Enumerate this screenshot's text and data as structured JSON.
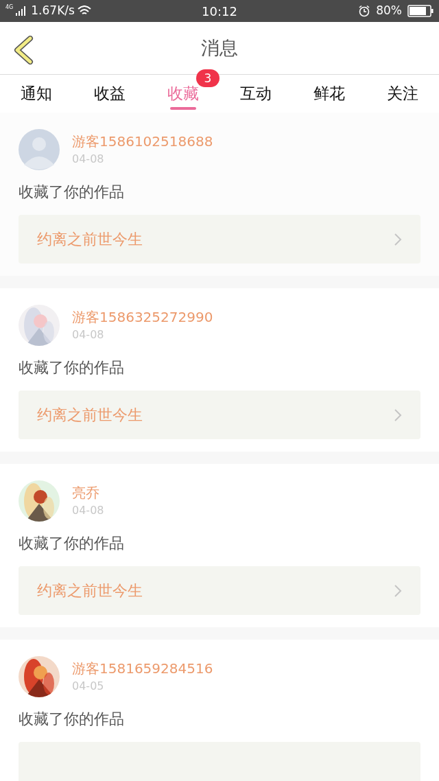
{
  "status_bar": {
    "network": "4G",
    "speed": "1.67K/s",
    "time": "10:12",
    "battery": "80%"
  },
  "header": {
    "title": "消息"
  },
  "tabs": [
    {
      "label": "通知",
      "selected": false
    },
    {
      "label": "收益",
      "selected": false
    },
    {
      "label": "收藏",
      "selected": true,
      "badge": "3"
    },
    {
      "label": "互动",
      "selected": false
    },
    {
      "label": "鲜花",
      "selected": false
    },
    {
      "label": "关注",
      "selected": false
    }
  ],
  "messages": [
    {
      "kind": "default",
      "name": "游客1586102518688",
      "date": "04-08",
      "action": "收藏了你的作品",
      "work": "约离之前世今生"
    },
    {
      "kind": "picture",
      "name": "游客1586325272990",
      "date": "04-08",
      "action": "收藏了你的作品",
      "work": "约离之前世今生"
    },
    {
      "kind": "picture",
      "name": "亮乔",
      "date": "04-08",
      "action": "收藏了你的作品",
      "work": "约离之前世今生"
    },
    {
      "kind": "picture",
      "name": "游客1581659284516",
      "date": "04-05",
      "action": "收藏了你的作品"
    }
  ]
}
